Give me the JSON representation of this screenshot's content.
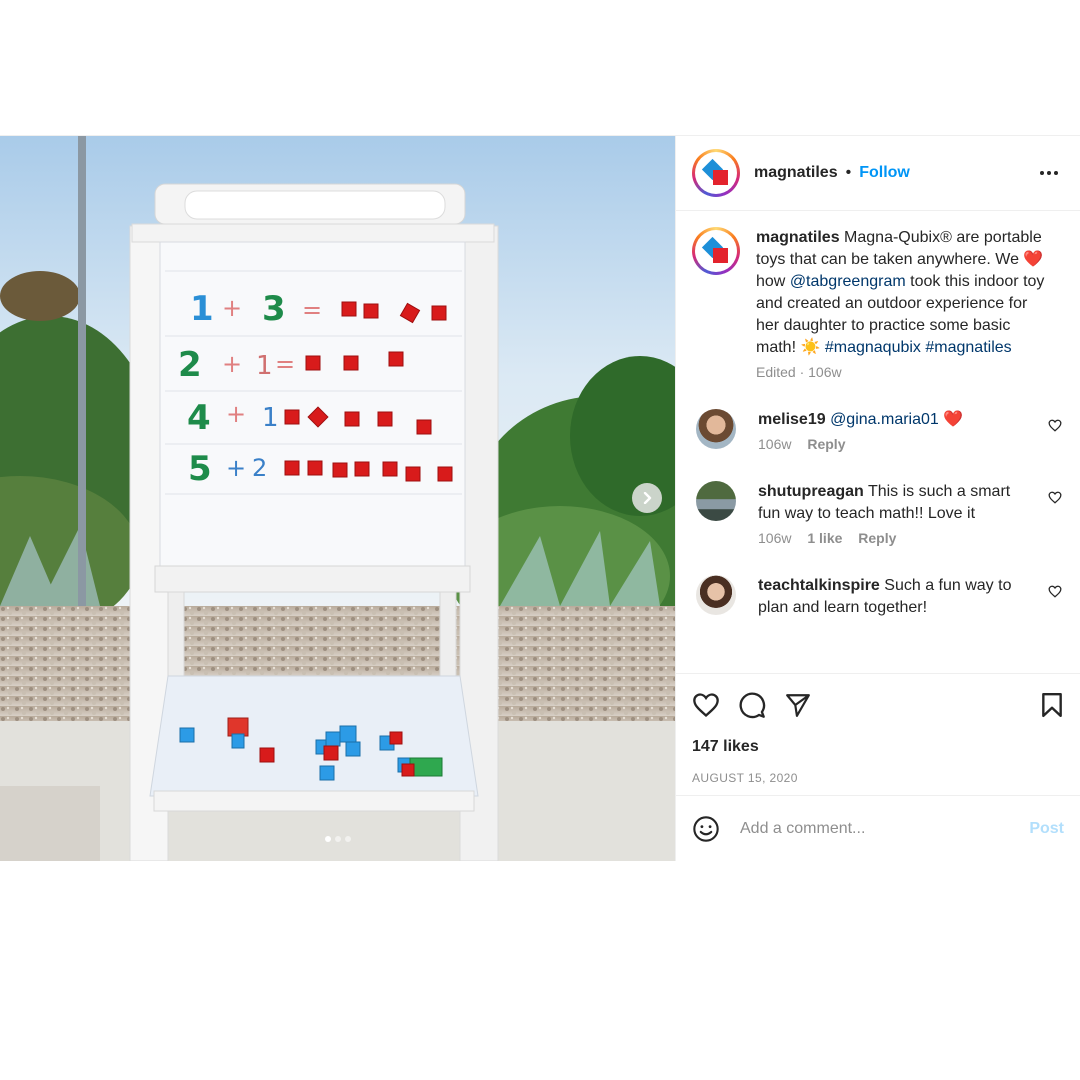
{
  "account": {
    "username": "magnatiles",
    "separator": "•",
    "follow_label": "Follow",
    "avatar_icon": "magnatiles-logo-icon",
    "brand_colors": {
      "red": "#e3232d",
      "blue": "#1d8fd8"
    }
  },
  "caption": {
    "username": "magnatiles",
    "text_1": "Magna-Qubix® are portable toys that can be taken anywhere. We",
    "heart": "❤️",
    "text_2": "how",
    "mention": "@tabgreengram",
    "text_3": "took this indoor toy and created an outdoor experience for her daughter to practice some basic math!",
    "sun": "☀️",
    "hashtag_1": "#magnaqubix",
    "hashtag_2": "#magnatiles",
    "edited": "Edited · 106w"
  },
  "comments": [
    {
      "username": "melise19",
      "mention": "@gina.maria01",
      "text": "❤️",
      "time": "106w",
      "likes": "",
      "reply": "Reply"
    },
    {
      "username": "shutupreagan",
      "mention": "",
      "text": "This is such a smart fun way to teach math!! Love it",
      "time": "106w",
      "likes": "1 like",
      "reply": "Reply"
    },
    {
      "username": "teachtalkinspire",
      "mention": "",
      "text": "Such a fun way to plan and learn together!",
      "time": "",
      "likes": "",
      "reply": ""
    }
  ],
  "actions": {
    "like_icon": "heart-icon",
    "comment_icon": "comment-bubble-icon",
    "share_icon": "paper-plane-icon",
    "save_icon": "bookmark-icon"
  },
  "likes_text": "147 likes",
  "date_text": "AUGUST 15, 2020",
  "add_comment": {
    "placeholder": "Add a comment...",
    "post_label": "Post",
    "emoji_icon": "smiley-icon"
  },
  "carousel": {
    "total": 3,
    "current": 1
  },
  "whiteboard": {
    "rows": [
      {
        "a": "1",
        "op1": "+",
        "b": "3",
        "op2": "="
      },
      {
        "a": "2",
        "op1": "+",
        "b": "1",
        "op2": "="
      },
      {
        "a": "4",
        "op1": "+",
        "b": "1",
        "op2": ""
      },
      {
        "a": "5",
        "op1": "+",
        "b": "2",
        "op2": ""
      }
    ]
  },
  "colors": {
    "follow_blue": "#0095f6",
    "link_blue": "#00376b",
    "muted": "#8e8e8e",
    "post_disabled": "#b2dffc",
    "cube_red": "#d81b1b",
    "digit_green": "#1e8b4a",
    "digit_blue": "#2a8fd6"
  }
}
